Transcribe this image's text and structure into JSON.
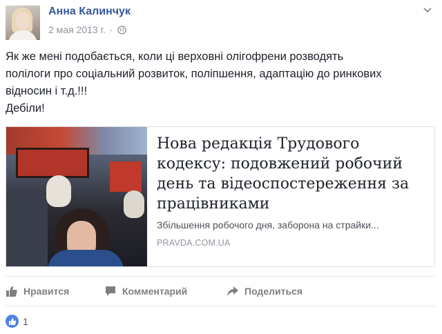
{
  "post": {
    "author": "Анна Калинчук",
    "date": "2 мая 2013 г.",
    "separator": "·",
    "message_lines": [
      "Як же мені подобається, коли ці верховні олігофрени розводять",
      "полілоги про соціальний розвиток, поліпшення, адаптацію до ринкових",
      "відносин і т.д.!!!",
      "Дебіли!"
    ]
  },
  "link_preview": {
    "title": "Нова редакція Трудового кодексу: подовжений робочий день та відеоспостереження за працівниками",
    "description": "Збільшення робочого дня, заборона на страйки...",
    "domain": "PRAVDA.COM.UA"
  },
  "actions": {
    "like": "Нравится",
    "comment": "Комментарий",
    "share": "Поделиться"
  },
  "reactions": {
    "count": "1"
  },
  "icons": [
    "globe-icon",
    "chevron-down-icon",
    "like-icon",
    "comment-icon",
    "share-icon"
  ],
  "colors": {
    "author": "#365899",
    "meta": "#90949c",
    "action": "#7f7f7f",
    "like_badge": "#4c82e6"
  }
}
